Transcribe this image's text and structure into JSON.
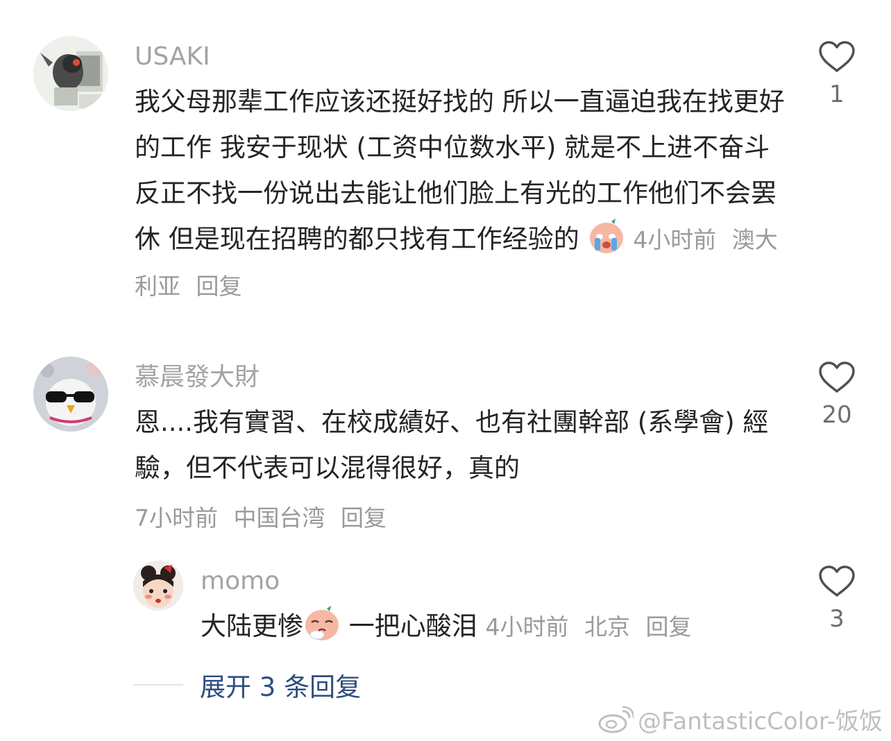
{
  "comments": [
    {
      "username": "USAKI",
      "text": "我父母那辈工作应该还挺好找的 所以一直逼迫我在找更好的工作 我安于现状 (工资中位数水平) 就是不上进不奋斗 反正不找一份说出去能让他们脸上有光的工作他们不会罢休 但是现在招聘的都只找有工作经验的",
      "emoji": "crying-emoji",
      "time": "4小时前",
      "location": "澳大利亚",
      "reply": "回复",
      "likes": "1"
    },
    {
      "username": "慕晨發大財",
      "text": "恩....我有實習、在校成績好、也有社團幹部 (系學會) 經驗，但不代表可以混得很好，真的",
      "time": "7小时前",
      "location": "中国台湾",
      "reply": "回复",
      "likes": "20"
    },
    {
      "username": "momo",
      "text_before": "大陆更惨",
      "emoji": "sad-emoji",
      "text_after": " 一把心酸泪",
      "time": "4小时前",
      "location": "北京",
      "reply": "回复",
      "likes": "3"
    }
  ],
  "expand_replies": "展开 3 条回复",
  "watermark": "@FantasticColor-饭饭",
  "colors": {
    "username": "#a3a3a3",
    "text": "#242424",
    "meta": "#9a9a9a",
    "expand": "#2d4e7e"
  }
}
